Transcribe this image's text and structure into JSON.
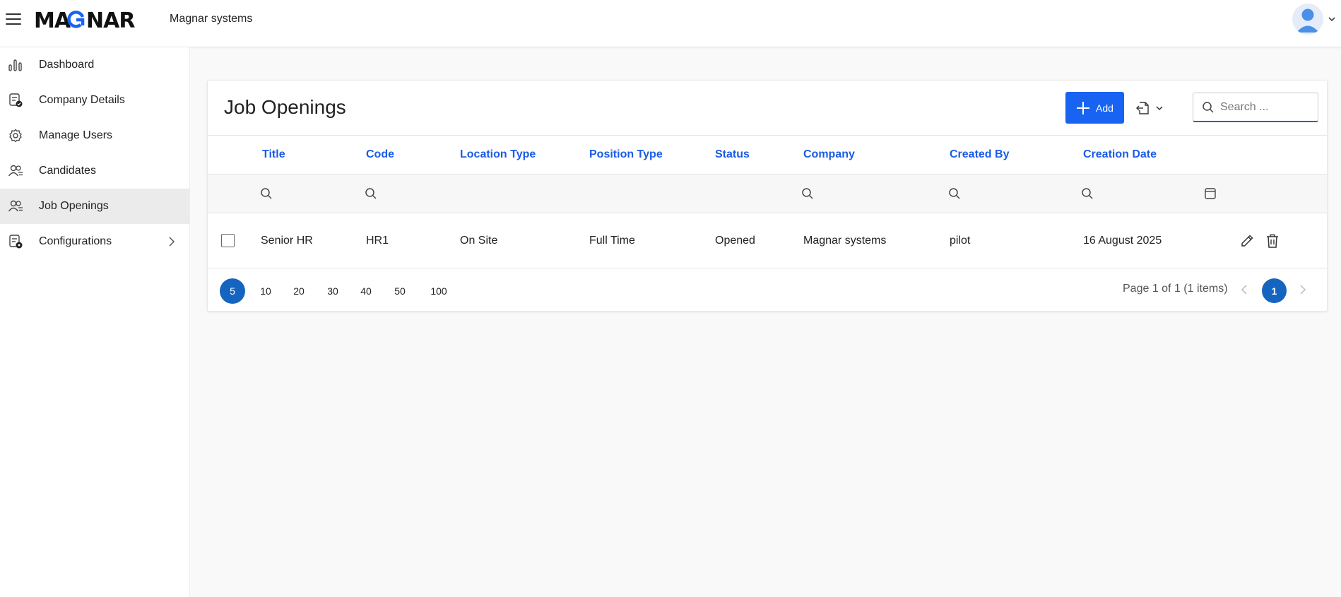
{
  "header": {
    "logo_text": "MAGNAR",
    "company_name": "Magnar systems",
    "hamburger_icon": "hamburger-menu-icon",
    "avatar_icon": "user-avatar-icon",
    "avatar_caret_icon": "chevron-down-icon"
  },
  "sidebar": {
    "items": [
      {
        "label": "Dashboard",
        "icon": "bar-chart-icon"
      },
      {
        "label": "Company Details",
        "icon": "company-details-icon"
      },
      {
        "label": "Manage Users",
        "icon": "gear-icon"
      },
      {
        "label": "Candidates",
        "icon": "users-icon"
      },
      {
        "label": "Job Openings",
        "icon": "users-icon",
        "active": true
      },
      {
        "label": "Configurations",
        "icon": "configurations-icon",
        "has_submenu": true
      }
    ]
  },
  "main": {
    "title": "Job Openings",
    "add_label": "Add",
    "search_placeholder": "Search ...",
    "columns": [
      "Title",
      "Code",
      "Location Type",
      "Position Type",
      "Status",
      "Company",
      "Created By",
      "Creation Date"
    ],
    "rows": [
      {
        "title": "Senior HR",
        "code": "HR1",
        "location_type": "On Site",
        "position_type": "Full Time",
        "status": "Opened",
        "company": "Magnar systems",
        "created_by": "pilot",
        "creation_date": "16 August 2025"
      }
    ],
    "pager": {
      "page_sizes": [
        "5",
        "10",
        "20",
        "30",
        "40",
        "50",
        "100"
      ],
      "selected_size": "5",
      "info": "Page 1 of 1 (1 items)",
      "current_page": "1"
    }
  },
  "colors": {
    "accent": "#1863f2",
    "header_text": "#1a5ce6",
    "pager_active": "#1565c0",
    "active_nav_bg": "#ebebeb"
  }
}
